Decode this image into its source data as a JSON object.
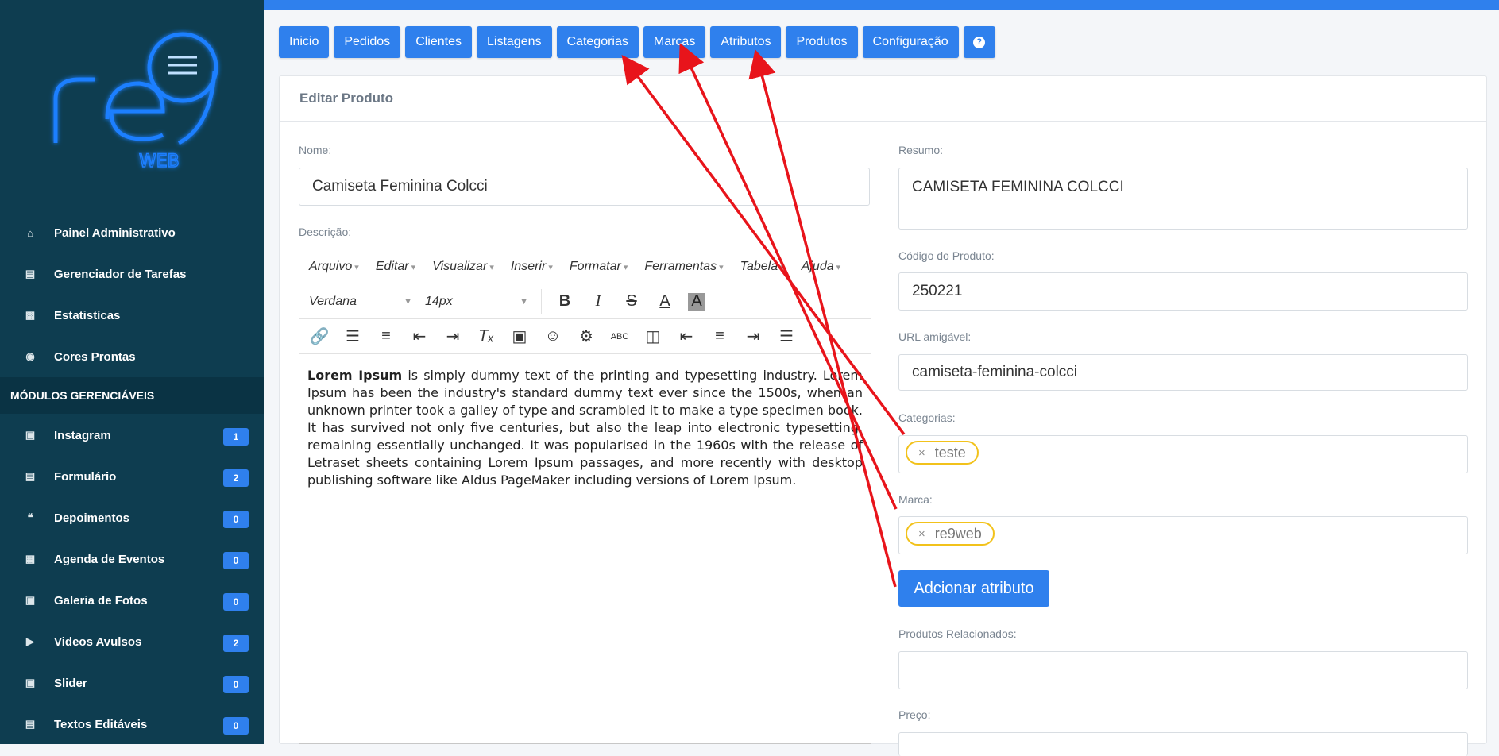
{
  "sidebar": {
    "nav": [
      {
        "label": "Painel Administrativo",
        "icon": "home-icon"
      },
      {
        "label": "Gerenciador de Tarefas",
        "icon": "tasks-icon"
      },
      {
        "label": "Estatistícas",
        "icon": "stats-icon"
      },
      {
        "label": "Cores Prontas",
        "icon": "palette-icon"
      }
    ],
    "section_title": "MÓDULOS GERENCIÁVEIS",
    "modules": [
      {
        "label": "Instagram",
        "count": "1",
        "icon": "instagram-icon"
      },
      {
        "label": "Formulário",
        "count": "2",
        "icon": "form-icon"
      },
      {
        "label": "Depoimentos",
        "count": "0",
        "icon": "quote-icon"
      },
      {
        "label": "Agenda de Eventos",
        "count": "0",
        "icon": "calendar-icon"
      },
      {
        "label": "Galeria de Fotos",
        "count": "0",
        "icon": "image-icon"
      },
      {
        "label": "Videos Avulsos",
        "count": "2",
        "icon": "video-icon"
      },
      {
        "label": "Slider",
        "count": "0",
        "icon": "slider-icon"
      },
      {
        "label": "Textos Editáveis",
        "count": "0",
        "icon": "document-icon"
      }
    ]
  },
  "tabs": [
    "Inicio",
    "Pedidos",
    "Clientes",
    "Listagens",
    "Categorias",
    "Marcas",
    "Atributos",
    "Produtos",
    "Configuração"
  ],
  "card": {
    "title": "Editar Produto"
  },
  "form": {
    "nome_label": "Nome:",
    "nome_value": "Camiseta Feminina Colcci",
    "descricao_label": "Descrição:",
    "resumo_label": "Resumo:",
    "resumo_value": "CAMISETA FEMININA COLCCI",
    "codigo_label": "Código do Produto:",
    "codigo_value": "250221",
    "url_label": "URL amigável:",
    "url_value": "camiseta-feminina-colcci",
    "categorias_label": "Categorias:",
    "categoria_tag": "teste",
    "marca_label": "Marca:",
    "marca_tag": "re9web",
    "add_attr_button": "Adcionar atributo",
    "relacionados_label": "Produtos Relacionados:",
    "preco_label": "Preço:"
  },
  "editor": {
    "menus": [
      "Arquivo",
      "Editar",
      "Visualizar",
      "Inserir",
      "Formatar",
      "Ferramentas",
      "Tabela",
      "Ajuda"
    ],
    "font": "Verdana",
    "size": "14px",
    "content_bold": "Lorem Ipsum",
    "content_text": " is simply dummy text of the printing and typesetting industry. Lorem Ipsum has been the industry's standard dummy text ever since the 1500s, when an unknown printer took a galley of type and scrambled it to make a type specimen book. It has survived not only five centuries, but also the leap into electronic typesetting, remaining essentially unchanged. It was popularised in the 1960s with the release of Letraset sheets containing Lorem Ipsum passages, and more recently with desktop publishing software like Aldus PageMaker including versions of Lorem Ipsum."
  },
  "colors": {
    "accent": "#2f80ed",
    "sidebar": "#0e3d50",
    "tag_border": "#f2c21b",
    "annotation": "#e8141b"
  }
}
